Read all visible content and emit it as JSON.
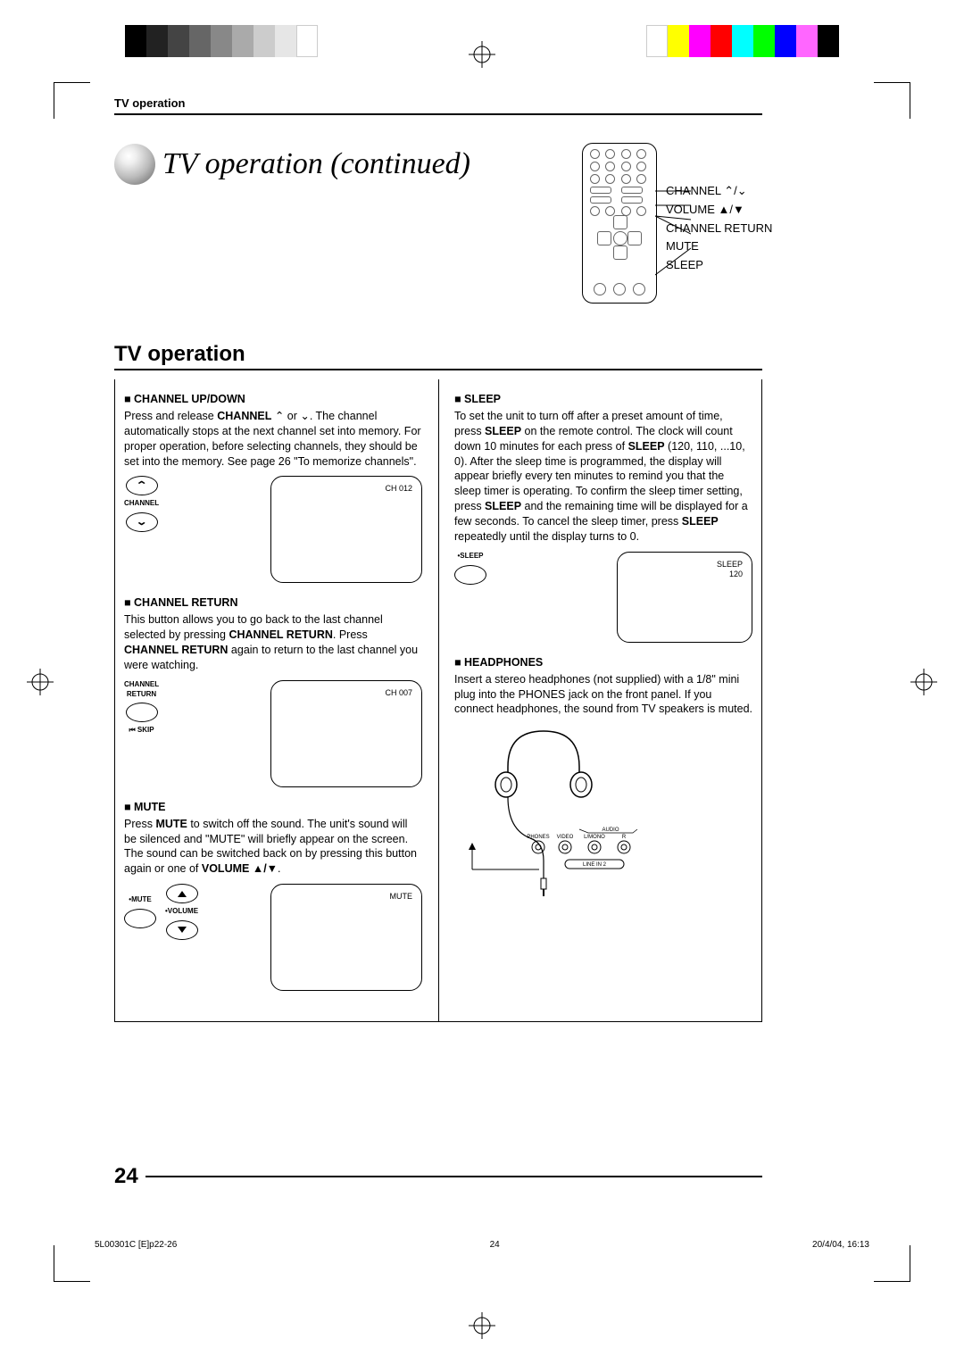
{
  "header": {
    "running_head": "TV operation",
    "title": "TV operation (continued)"
  },
  "remote_labels": {
    "channel": "CHANNEL ⌃/⌄",
    "volume": "VOLUME ▲/▼",
    "channel_return": "CHANNEL RETURN",
    "mute": "MUTE",
    "sleep": "SLEEP"
  },
  "section_heading": "TV operation",
  "left_col": {
    "channel_updown": {
      "heading": "CHANNEL UP/DOWN",
      "text_1": "Press and release ",
      "bold_1": "CHANNEL",
      "text_2": " ⌃ or ⌄. The channel automatically stops at the next channel set into memory. For proper operation, before selecting channels, they should be set into the memory. See page 26 \"To memorize channels\".",
      "button_label": "CHANNEL",
      "osd": "CH 012"
    },
    "channel_return": {
      "heading": "CHANNEL RETURN",
      "text_1": "This button allows you to go back to the last channel selected by pressing ",
      "bold_1": "CHANNEL RETURN",
      "text_2": ". Press ",
      "bold_2": "CHANNEL RETURN",
      "text_3": " again to return to the last channel you were watching.",
      "button_label_1": "CHANNEL",
      "button_label_2": "RETURN",
      "button_label_3": "⏮ SKIP",
      "osd": "CH 007"
    },
    "mute": {
      "heading": "MUTE",
      "text_1": "Press ",
      "bold_1": "MUTE",
      "text_2": " to switch off the sound. The unit's sound will be silenced and \"MUTE\" will briefly appear on the screen. The sound can be switched back on by pressing this button again or one of ",
      "bold_2": "VOLUME ▲/▼",
      "text_3": ".",
      "mute_label": "•MUTE",
      "volume_label": "•VOLUME",
      "osd": "MUTE"
    }
  },
  "right_col": {
    "sleep": {
      "heading": "SLEEP",
      "text_1": "To set the unit to turn off after a preset amount of time, press ",
      "bold_1": "SLEEP",
      "text_2": " on the remote control. The clock will count down 10 minutes for each press of ",
      "bold_2": "SLEEP",
      "text_3": " (120, 110, ...10, 0). After the sleep time is programmed, the display will appear briefly every ten minutes to remind you that the sleep timer is operating. To confirm the sleep timer setting, press ",
      "bold_3": "SLEEP",
      "text_4": " and the remaining time will be displayed for a few seconds. To cancel the sleep timer, press ",
      "bold_4": "SLEEP",
      "text_5": " repeatedly until the display turns to 0.",
      "button_label": "•SLEEP",
      "osd_1": "SLEEP",
      "osd_2": "120"
    },
    "headphones": {
      "heading": "HEADPHONES",
      "text": "Insert a stereo headphones (not supplied) with a 1/8\" mini plug into the PHONES jack on the front panel. If you connect headphones, the sound from TV speakers is muted.",
      "jack_labels": {
        "phones": "PHONES",
        "video": "VIDEO",
        "lmono": "L/MONO",
        "audio": "AUDIO",
        "r": "R",
        "linein": "LINE IN 2"
      }
    }
  },
  "page_number": "24",
  "footer": {
    "left": "5L00301C [E]p22-26",
    "center": "24",
    "right": "20/4/04, 16:13"
  }
}
